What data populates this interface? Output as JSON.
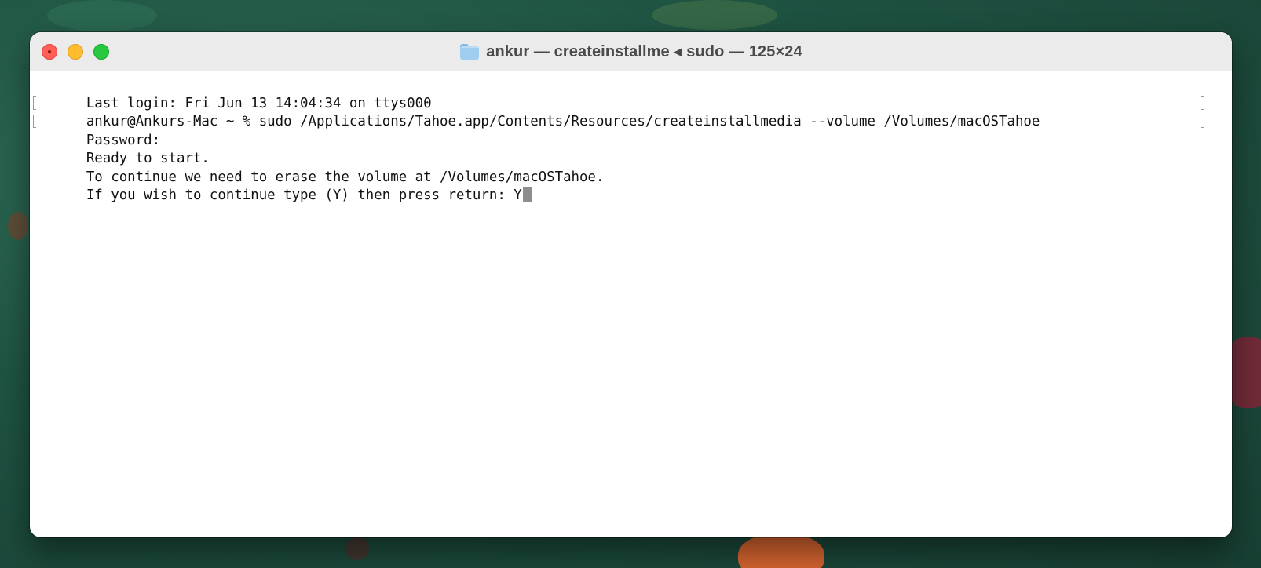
{
  "window": {
    "title": "ankur — createinstallme ◂ sudo — 125×24",
    "icon": "folder-icon",
    "traffic_lights": {
      "close_color": "#fe5f57",
      "minimize_color": "#febc2e",
      "zoom_color": "#28c840"
    }
  },
  "terminal": {
    "lines": [
      "Last login: Fri Jun 13 14:04:34 on ttys000",
      "ankur@Ankurs-Mac ~ % sudo /Applications/Tahoe.app/Contents/Resources/createinstallmedia --volume /Volumes/macOSTahoe",
      "Password:",
      "Ready to start.",
      "To continue we need to erase the volume at /Volumes/macOSTahoe.",
      "If you wish to continue type (Y) then press return: Y"
    ]
  }
}
